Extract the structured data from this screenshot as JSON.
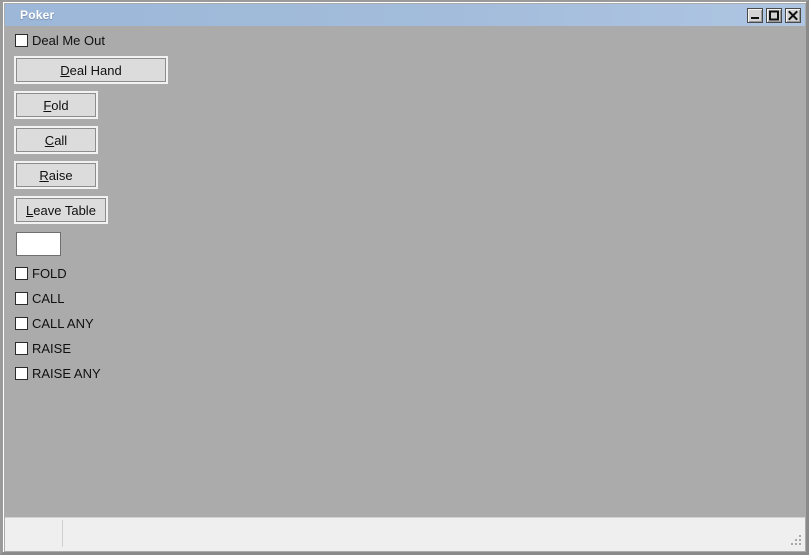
{
  "window": {
    "title": "Poker",
    "controls": [
      {
        "name": "minimize",
        "icon": "minimize-icon",
        "label": "Minimize"
      },
      {
        "name": "maximize",
        "icon": "maximize-icon",
        "label": "Maximize"
      },
      {
        "name": "close",
        "icon": "close-icon",
        "label": "Close"
      }
    ],
    "colors": {
      "titlebar": "#a3bcdb",
      "client_bg": "#ababab",
      "button_face": "#dcdcdc",
      "statusbar": "#efefef",
      "frame": "#9a9a9a"
    }
  },
  "deal_me_out": {
    "label": "Deal Me Out",
    "checked": false
  },
  "buttons": [
    {
      "name": "deal-hand",
      "label": "Deal Hand",
      "accel": "D"
    },
    {
      "name": "fold",
      "label": "Fold",
      "accel": "F"
    },
    {
      "name": "call",
      "label": "Call",
      "accel": "C"
    },
    {
      "name": "raise",
      "label": "Raise",
      "accel": "R"
    },
    {
      "name": "leave-table",
      "label": "Leave Table",
      "accel": "L"
    }
  ],
  "amount_field": {
    "value": "",
    "placeholder": ""
  },
  "auto_actions": [
    {
      "name": "fold",
      "label": "FOLD",
      "checked": false
    },
    {
      "name": "call",
      "label": "CALL",
      "checked": false
    },
    {
      "name": "call-any",
      "label": "CALL ANY",
      "checked": false
    },
    {
      "name": "raise",
      "label": "RAISE",
      "checked": false
    },
    {
      "name": "raise-any",
      "label": "RAISE ANY",
      "checked": false
    }
  ],
  "statusbar": {
    "left_text": "",
    "right_text": "",
    "grip": "resize-grip"
  }
}
